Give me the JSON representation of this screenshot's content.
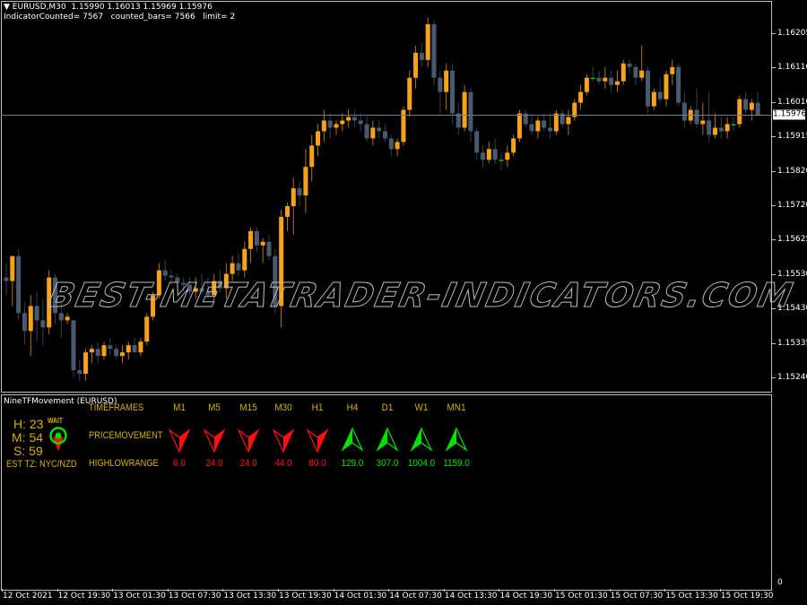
{
  "window": {
    "symbol_line": "EURUSD,M30  1.15990 1.16013 1.15969 1.15976",
    "counter_line": "IndicatorCounted= 7567   counted_bars= 7566   limit= 2"
  },
  "price_axis": {
    "labels": [
      "1.16205",
      "1.16110",
      "1.16010",
      "1.15915",
      "1.15820",
      "1.15720",
      "1.15625",
      "1.15530",
      "1.15430",
      "1.15335",
      "1.15240"
    ],
    "current_price": "1.15976",
    "current_price_value": 1.15976
  },
  "time_axis": {
    "labels": [
      "12 Oct 2021",
      "12 Oct 19:30",
      "13 Oct 01:30",
      "13 Oct 07:30",
      "13 Oct 13:30",
      "13 Oct 19:30",
      "14 Oct 01:30",
      "14 Oct 07:30",
      "14 Oct 13:30",
      "14 Oct 19:30",
      "15 Oct 01:30",
      "15 Oct 07:30",
      "15 Oct 13:30",
      "15 Oct 19:30"
    ]
  },
  "watermark": "BEST-METATRADER-INDICATORS.COM",
  "indicator": {
    "title": "NineTFMovement (EURUSD)",
    "zero_label": "0",
    "clock": {
      "h": "H: 23",
      "m": "M: 54",
      "s": "S: 59",
      "status": "WAIT",
      "tz": "EST TZ:  NYC/NZD"
    },
    "row_labels": {
      "timeframes": "TIMEFRAMES",
      "movement": "PRICEMOVEMENT",
      "range": "HIGHLOWRANGE"
    },
    "timeframes": [
      {
        "name": "M1",
        "direction": "down",
        "range": "6.0"
      },
      {
        "name": "M5",
        "direction": "down",
        "range": "24.0"
      },
      {
        "name": "M15",
        "direction": "down",
        "range": "24.0"
      },
      {
        "name": "M30",
        "direction": "down",
        "range": "44.0"
      },
      {
        "name": "H1",
        "direction": "down",
        "range": "80.0"
      },
      {
        "name": "H4",
        "direction": "up",
        "range": "129.0"
      },
      {
        "name": "D1",
        "direction": "up",
        "range": "307.0"
      },
      {
        "name": "W1",
        "direction": "up",
        "range": "1004.0"
      },
      {
        "name": "MN1",
        "direction": "up",
        "range": "1159.0"
      }
    ],
    "colors": {
      "up": "#00e000",
      "down": "#ff1010",
      "label": "#d4af00"
    }
  },
  "colors": {
    "bull": "#f7a21b",
    "bear": "#4a5a6e",
    "doji": "#00c000",
    "price_line": "#6d7d8d"
  },
  "chart_data": {
    "type": "candlestick",
    "symbol": "EURUSD",
    "timeframe": "M30",
    "ylim": [
      1.15205,
      1.16265
    ],
    "ohlc": [
      [
        1.1552,
        1.1556,
        1.1547,
        1.1551
      ],
      [
        1.1551,
        1.1558,
        1.1544,
        1.1558
      ],
      [
        1.1558,
        1.156,
        1.154,
        1.1542
      ],
      [
        1.1542,
        1.1545,
        1.1533,
        1.1537
      ],
      [
        1.1537,
        1.1547,
        1.153,
        1.1544
      ],
      [
        1.1544,
        1.1548,
        1.1534,
        1.154
      ],
      [
        1.154,
        1.1546,
        1.1533,
        1.1538
      ],
      [
        1.1538,
        1.1554,
        1.1536,
        1.1552
      ],
      [
        1.1552,
        1.1553,
        1.1539,
        1.1542
      ],
      [
        1.1542,
        1.1545,
        1.1535,
        1.154
      ],
      [
        1.154,
        1.1542,
        1.1539,
        1.1541
      ],
      [
        1.154,
        1.154,
        1.1524,
        1.1526
      ],
      [
        1.1526,
        1.1529,
        1.1523,
        1.1525
      ],
      [
        1.1525,
        1.1532,
        1.1523,
        1.1531
      ],
      [
        1.1531,
        1.1533,
        1.1528,
        1.1532
      ],
      [
        1.1532,
        1.1534,
        1.1528,
        1.153
      ],
      [
        1.153,
        1.1534,
        1.1529,
        1.1533
      ],
      [
        1.1533,
        1.1535,
        1.153,
        1.1532
      ],
      [
        1.1532,
        1.1533,
        1.1529,
        1.153
      ],
      [
        1.153,
        1.1533,
        1.1528,
        1.1531
      ],
      [
        1.1531,
        1.1534,
        1.1529,
        1.1533
      ],
      [
        1.1533,
        1.1535,
        1.1531,
        1.1531
      ],
      [
        1.1531,
        1.1535,
        1.153,
        1.1534
      ],
      [
        1.1534,
        1.1542,
        1.1533,
        1.1541
      ],
      [
        1.1541,
        1.1548,
        1.154,
        1.1547
      ],
      [
        1.1547,
        1.1556,
        1.1546,
        1.1554
      ],
      [
        1.1554,
        1.1557,
        1.1551,
        1.15525
      ],
      [
        1.15525,
        1.1554,
        1.155,
        1.1552
      ],
      [
        1.1552,
        1.1553,
        1.1549,
        1.15505
      ],
      [
        1.15505,
        1.1552,
        1.1548,
        1.155
      ],
      [
        1.155,
        1.1552,
        1.1547,
        1.1548
      ],
      [
        1.1548,
        1.1552,
        1.1546,
        1.1549
      ],
      [
        1.1549,
        1.1553,
        1.1547,
        1.1548
      ],
      [
        1.1548,
        1.1552,
        1.1546,
        1.1547
      ],
      [
        1.1547,
        1.1553,
        1.1545,
        1.1551
      ],
      [
        1.1551,
        1.1554,
        1.1548,
        1.1549
      ],
      [
        1.1549,
        1.1556,
        1.1546,
        1.1553
      ],
      [
        1.1553,
        1.1558,
        1.1551,
        1.1556
      ],
      [
        1.1556,
        1.1559,
        1.1552,
        1.1554
      ],
      [
        1.1554,
        1.1562,
        1.1552,
        1.156
      ],
      [
        1.156,
        1.1566,
        1.1556,
        1.1565
      ],
      [
        1.1565,
        1.1566,
        1.1559,
        1.1561
      ],
      [
        1.1561,
        1.1563,
        1.1556,
        1.1562
      ],
      [
        1.1562,
        1.1564,
        1.1557,
        1.1558
      ],
      [
        1.1558,
        1.156,
        1.1542,
        1.1544
      ],
      [
        1.1544,
        1.1571,
        1.1538,
        1.1569
      ],
      [
        1.1569,
        1.1573,
        1.1565,
        1.1572
      ],
      [
        1.1572,
        1.158,
        1.1564,
        1.1577
      ],
      [
        1.1577,
        1.1579,
        1.1572,
        1.1575
      ],
      [
        1.1575,
        1.1588,
        1.157,
        1.1583
      ],
      [
        1.1583,
        1.1592,
        1.1579,
        1.1589
      ],
      [
        1.1589,
        1.1595,
        1.1586,
        1.1593
      ],
      [
        1.1593,
        1.1599,
        1.159,
        1.1596
      ],
      [
        1.1596,
        1.1598,
        1.1591,
        1.1594
      ],
      [
        1.1594,
        1.1596,
        1.1592,
        1.1595
      ],
      [
        1.1595,
        1.1598,
        1.1593,
        1.1596
      ],
      [
        1.1596,
        1.1599,
        1.1594,
        1.1597
      ],
      [
        1.1597,
        1.1599,
        1.1594,
        1.1596
      ],
      [
        1.1596,
        1.1598,
        1.1593,
        1.1595
      ],
      [
        1.1595,
        1.1597,
        1.159,
        1.1591
      ],
      [
        1.1591,
        1.1596,
        1.1589,
        1.1594
      ],
      [
        1.1594,
        1.1596,
        1.1591,
        1.1593
      ],
      [
        1.1593,
        1.1595,
        1.159,
        1.1591
      ],
      [
        1.1591,
        1.1592,
        1.1586,
        1.1588
      ],
      [
        1.1588,
        1.1591,
        1.1586,
        1.159
      ],
      [
        1.159,
        1.16,
        1.1589,
        1.1599
      ],
      [
        1.1599,
        1.161,
        1.1597,
        1.1608
      ],
      [
        1.1608,
        1.1617,
        1.1605,
        1.1615
      ],
      [
        1.1615,
        1.1618,
        1.1611,
        1.1613
      ],
      [
        1.1613,
        1.1625,
        1.1611,
        1.1623
      ],
      [
        1.1623,
        1.1624,
        1.1606,
        1.1608
      ],
      [
        1.1608,
        1.161,
        1.1598,
        1.1604
      ],
      [
        1.1604,
        1.1612,
        1.1599,
        1.161
      ],
      [
        1.161,
        1.1612,
        1.1595,
        1.1598
      ],
      [
        1.1598,
        1.1601,
        1.1592,
        1.1594
      ],
      [
        1.1594,
        1.1606,
        1.1593,
        1.1604
      ],
      [
        1.1604,
        1.1605,
        1.159,
        1.1593
      ],
      [
        1.1593,
        1.1594,
        1.1585,
        1.1587
      ],
      [
        1.1587,
        1.1589,
        1.1583,
        1.1585
      ],
      [
        1.1585,
        1.159,
        1.1584,
        1.1588
      ],
      [
        1.1588,
        1.1591,
        1.1584,
        1.1585
      ],
      [
        1.1585,
        1.1587,
        1.1582,
        1.1585
      ],
      [
        1.1585,
        1.1589,
        1.1583,
        1.1587
      ],
      [
        1.1587,
        1.1592,
        1.1586,
        1.1591
      ],
      [
        1.1591,
        1.1599,
        1.159,
        1.1598
      ],
      [
        1.1598,
        1.1599,
        1.1594,
        1.1595
      ],
      [
        1.1595,
        1.1598,
        1.1592,
        1.1593
      ],
      [
        1.1593,
        1.1597,
        1.1591,
        1.1596
      ],
      [
        1.1596,
        1.1598,
        1.1593,
        1.1594
      ],
      [
        1.1594,
        1.1598,
        1.1591,
        1.1593
      ],
      [
        1.1593,
        1.1599,
        1.1592,
        1.1598
      ],
      [
        1.1598,
        1.1599,
        1.1594,
        1.1595
      ],
      [
        1.1595,
        1.1599,
        1.1592,
        1.1597
      ],
      [
        1.1597,
        1.1602,
        1.1596,
        1.1601
      ],
      [
        1.1601,
        1.1606,
        1.1599,
        1.1604
      ],
      [
        1.1604,
        1.1609,
        1.1603,
        1.1608
      ],
      [
        1.1608,
        1.1611,
        1.1607,
        1.1608
      ],
      [
        1.1608,
        1.161,
        1.1606,
        1.1607
      ],
      [
        1.1607,
        1.1611,
        1.1605,
        1.1608
      ],
      [
        1.1608,
        1.161,
        1.1604,
        1.1606
      ],
      [
        1.1606,
        1.161,
        1.1604,
        1.1607
      ],
      [
        1.1607,
        1.1613,
        1.1606,
        1.1612
      ],
      [
        1.1612,
        1.1613,
        1.1609,
        1.1611
      ],
      [
        1.1611,
        1.1612,
        1.1606,
        1.1608
      ],
      [
        1.1608,
        1.1617,
        1.1607,
        1.161
      ],
      [
        1.161,
        1.1611,
        1.1598,
        1.16
      ],
      [
        1.16,
        1.1605,
        1.1599,
        1.1604
      ],
      [
        1.1604,
        1.1608,
        1.1601,
        1.1602
      ],
      [
        1.1602,
        1.161,
        1.16,
        1.1609
      ],
      [
        1.1609,
        1.1613,
        1.1606,
        1.1611
      ],
      [
        1.1611,
        1.1612,
        1.16,
        1.1601
      ],
      [
        1.1601,
        1.1604,
        1.1594,
        1.1596
      ],
      [
        1.1596,
        1.16,
        1.1595,
        1.1599
      ],
      [
        1.1599,
        1.1605,
        1.1594,
        1.1595
      ],
      [
        1.1595,
        1.1601,
        1.1592,
        1.1596
      ],
      [
        1.1596,
        1.1604,
        1.159,
        1.1592
      ],
      [
        1.1592,
        1.1598,
        1.1591,
        1.1594
      ],
      [
        1.1594,
        1.1597,
        1.1591,
        1.1593
      ],
      [
        1.1593,
        1.1597,
        1.1591,
        1.1595
      ],
      [
        1.1595,
        1.1597,
        1.1593,
        1.1595
      ],
      [
        1.1595,
        1.1603,
        1.1594,
        1.1602
      ],
      [
        1.1602,
        1.1604,
        1.1598,
        1.1599
      ],
      [
        1.1599,
        1.1602,
        1.1596,
        1.1601
      ],
      [
        1.1601,
        1.1604,
        1.1598,
        1.15976
      ]
    ]
  }
}
